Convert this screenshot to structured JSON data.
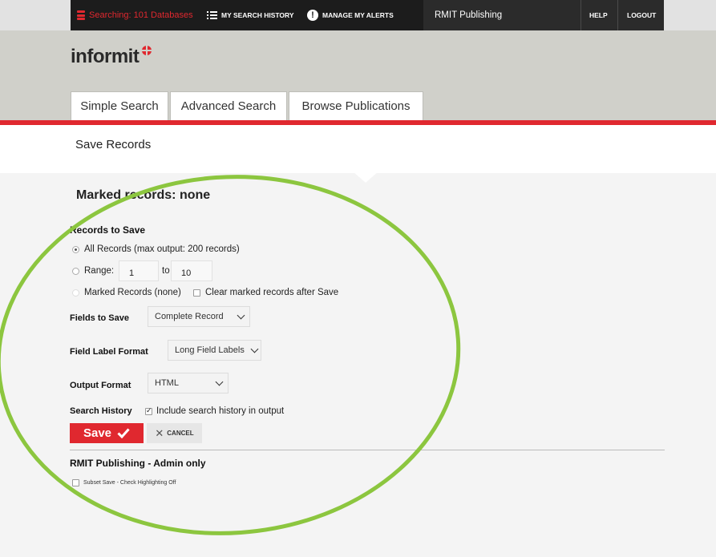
{
  "topbar": {
    "searching": "Searching: 101 Databases",
    "history": "MY SEARCH HISTORY",
    "alerts": "MANAGE MY ALERTS",
    "org": "RMIT Publishing",
    "help": "HELP",
    "logout": "LOGOUT",
    "colors": {
      "accent": "#e0282f",
      "dark": "#1c1c1c"
    }
  },
  "header": {
    "logo": "informit",
    "tabs": [
      {
        "label": "Simple Search"
      },
      {
        "label": "Advanced Search"
      },
      {
        "label": "Browse Publications"
      }
    ]
  },
  "page": {
    "title": "Save Records",
    "marked_title": "Marked records: none"
  },
  "form": {
    "records_heading": "Records to Save",
    "all_records": "All Records (max output: 200 records)",
    "range_label": "Range:",
    "range_from": "1",
    "range_to_label": "to",
    "range_to": "10",
    "marked_records": "Marked Records (none)",
    "clear_marked": "Clear marked records after Save",
    "fields_label": "Fields to Save",
    "fields_value": "Complete Record",
    "label_format_label": "Field Label Format",
    "label_format_value": "Long Field Labels",
    "output_label": "Output Format",
    "output_value": "HTML",
    "history_label": "Search History",
    "history_option": "Include search history in output",
    "save_label": "Save",
    "cancel_label": "CANCEL"
  },
  "admin": {
    "heading": "RMIT Publishing - Admin only",
    "subset": "Subset Save - Check Highlighting Off"
  }
}
